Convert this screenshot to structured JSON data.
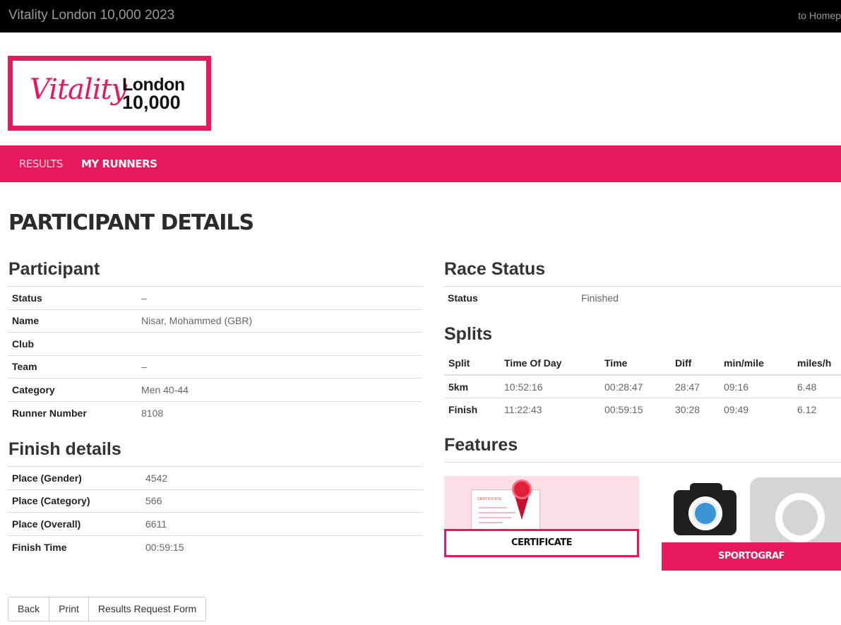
{
  "topbar": {
    "title": "Vitality London 10,000 2023",
    "home_link": "to Homep"
  },
  "logo": {
    "script": "Vitality",
    "line1": "London",
    "line2": "10,000"
  },
  "nav": {
    "results": "RESULTS",
    "my_runners": "MY RUNNERS"
  },
  "page_title": "PARTICIPANT DETAILS",
  "participant": {
    "heading": "Participant",
    "rows": [
      {
        "label": "Status",
        "value": "–"
      },
      {
        "label": "Name",
        "value": "Nisar, Mohammed (GBR)"
      },
      {
        "label": "Club",
        "value": ""
      },
      {
        "label": "Team",
        "value": "–"
      },
      {
        "label": "Category",
        "value": "Men 40-44"
      },
      {
        "label": "Runner Number",
        "value": "8108"
      }
    ]
  },
  "finish": {
    "heading": "Finish details",
    "rows": [
      {
        "label": "Place (Gender)",
        "value": "4542"
      },
      {
        "label": "Place (Category)",
        "value": "566"
      },
      {
        "label": "Place (Overall)",
        "value": "6611"
      },
      {
        "label": "Finish Time",
        "value": "00:59:15"
      }
    ]
  },
  "race_status": {
    "heading": "Race Status",
    "rows": [
      {
        "label": "Status",
        "value": "Finished"
      }
    ]
  },
  "splits": {
    "heading": "Splits",
    "columns": [
      "Split",
      "Time Of Day",
      "Time",
      "Diff",
      "min/mile",
      "miles/h"
    ],
    "rows": [
      [
        "5km",
        "10:52:16",
        "00:28:47",
        "28:47",
        "09:16",
        "6.48"
      ],
      [
        "Finish",
        "11:22:43",
        "00:59:15",
        "30:28",
        "09:49",
        "6.12"
      ]
    ]
  },
  "features": {
    "heading": "Features",
    "certificate_label": "CERTIFICATE",
    "certificate_paper_text": "CERTIFICATE",
    "sportograf_label": "SPORTOGRAF"
  },
  "buttons": {
    "back": "Back",
    "print": "Print",
    "request": "Results Request Form"
  },
  "colors": {
    "brand": "#e8195a",
    "topbar": "#000000"
  }
}
